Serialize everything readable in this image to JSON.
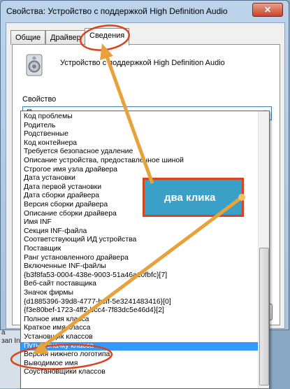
{
  "window": {
    "title": "Свойства: Устройство с поддержкой High Definition Audio",
    "close_label": "✕"
  },
  "tabs": [
    {
      "label": "Общие"
    },
    {
      "label": "Драйвер"
    },
    {
      "label": "Сведения"
    }
  ],
  "details": {
    "device_name": "Устройство с поддержкой High Definition Audio",
    "property_label": "Свойство",
    "selected_property": "Путь к значку класса"
  },
  "dropdown": {
    "items": [
      "Код проблемы",
      "Родитель",
      "Родственные",
      "Код контейнера",
      "Требуется безопасное удаление",
      "Описание устройства, предоставленное шиной",
      "Строгое имя узла драйвера",
      "Дата установки",
      "Дата первой установки",
      "Дата сборки драйвера",
      "Версия сборки драйвера",
      "Описание сборки драйвера",
      "Имя INF",
      "Секция INF-файла",
      "Соответствующий ИД устройства",
      "Поставщик",
      "Ранг установленного драйвера",
      "Включенные INF-файлы",
      "{b3f8fa53-0004-438e-9003-51a46a10fbfc}[7]",
      "Веб-сайт поставщика",
      "Значок фирмы",
      "{d1885396-39d8-4777-bcff-5e3241483416}[0]",
      "{f3e80bef-1723-4ff2-bcc4-7f83dc5e46d4}[2]",
      "Полное имя класса",
      "Краткое имя класса",
      "Установщик классов",
      "Путь к значку класса",
      "Версия нижнего логотипа",
      "Выводимое имя",
      "Соустановщики классов"
    ],
    "selected_index": 26
  },
  "annotation": {
    "label": "два клика"
  },
  "background": {
    "fragments": [
      "а",
      "зап Inf"
    ]
  },
  "colors": {
    "selection": "#3399ff",
    "badge": "#3aa0c8",
    "badge_border": "#d9441d",
    "arrow": "#e8a23a",
    "circle": "#d9441d"
  }
}
